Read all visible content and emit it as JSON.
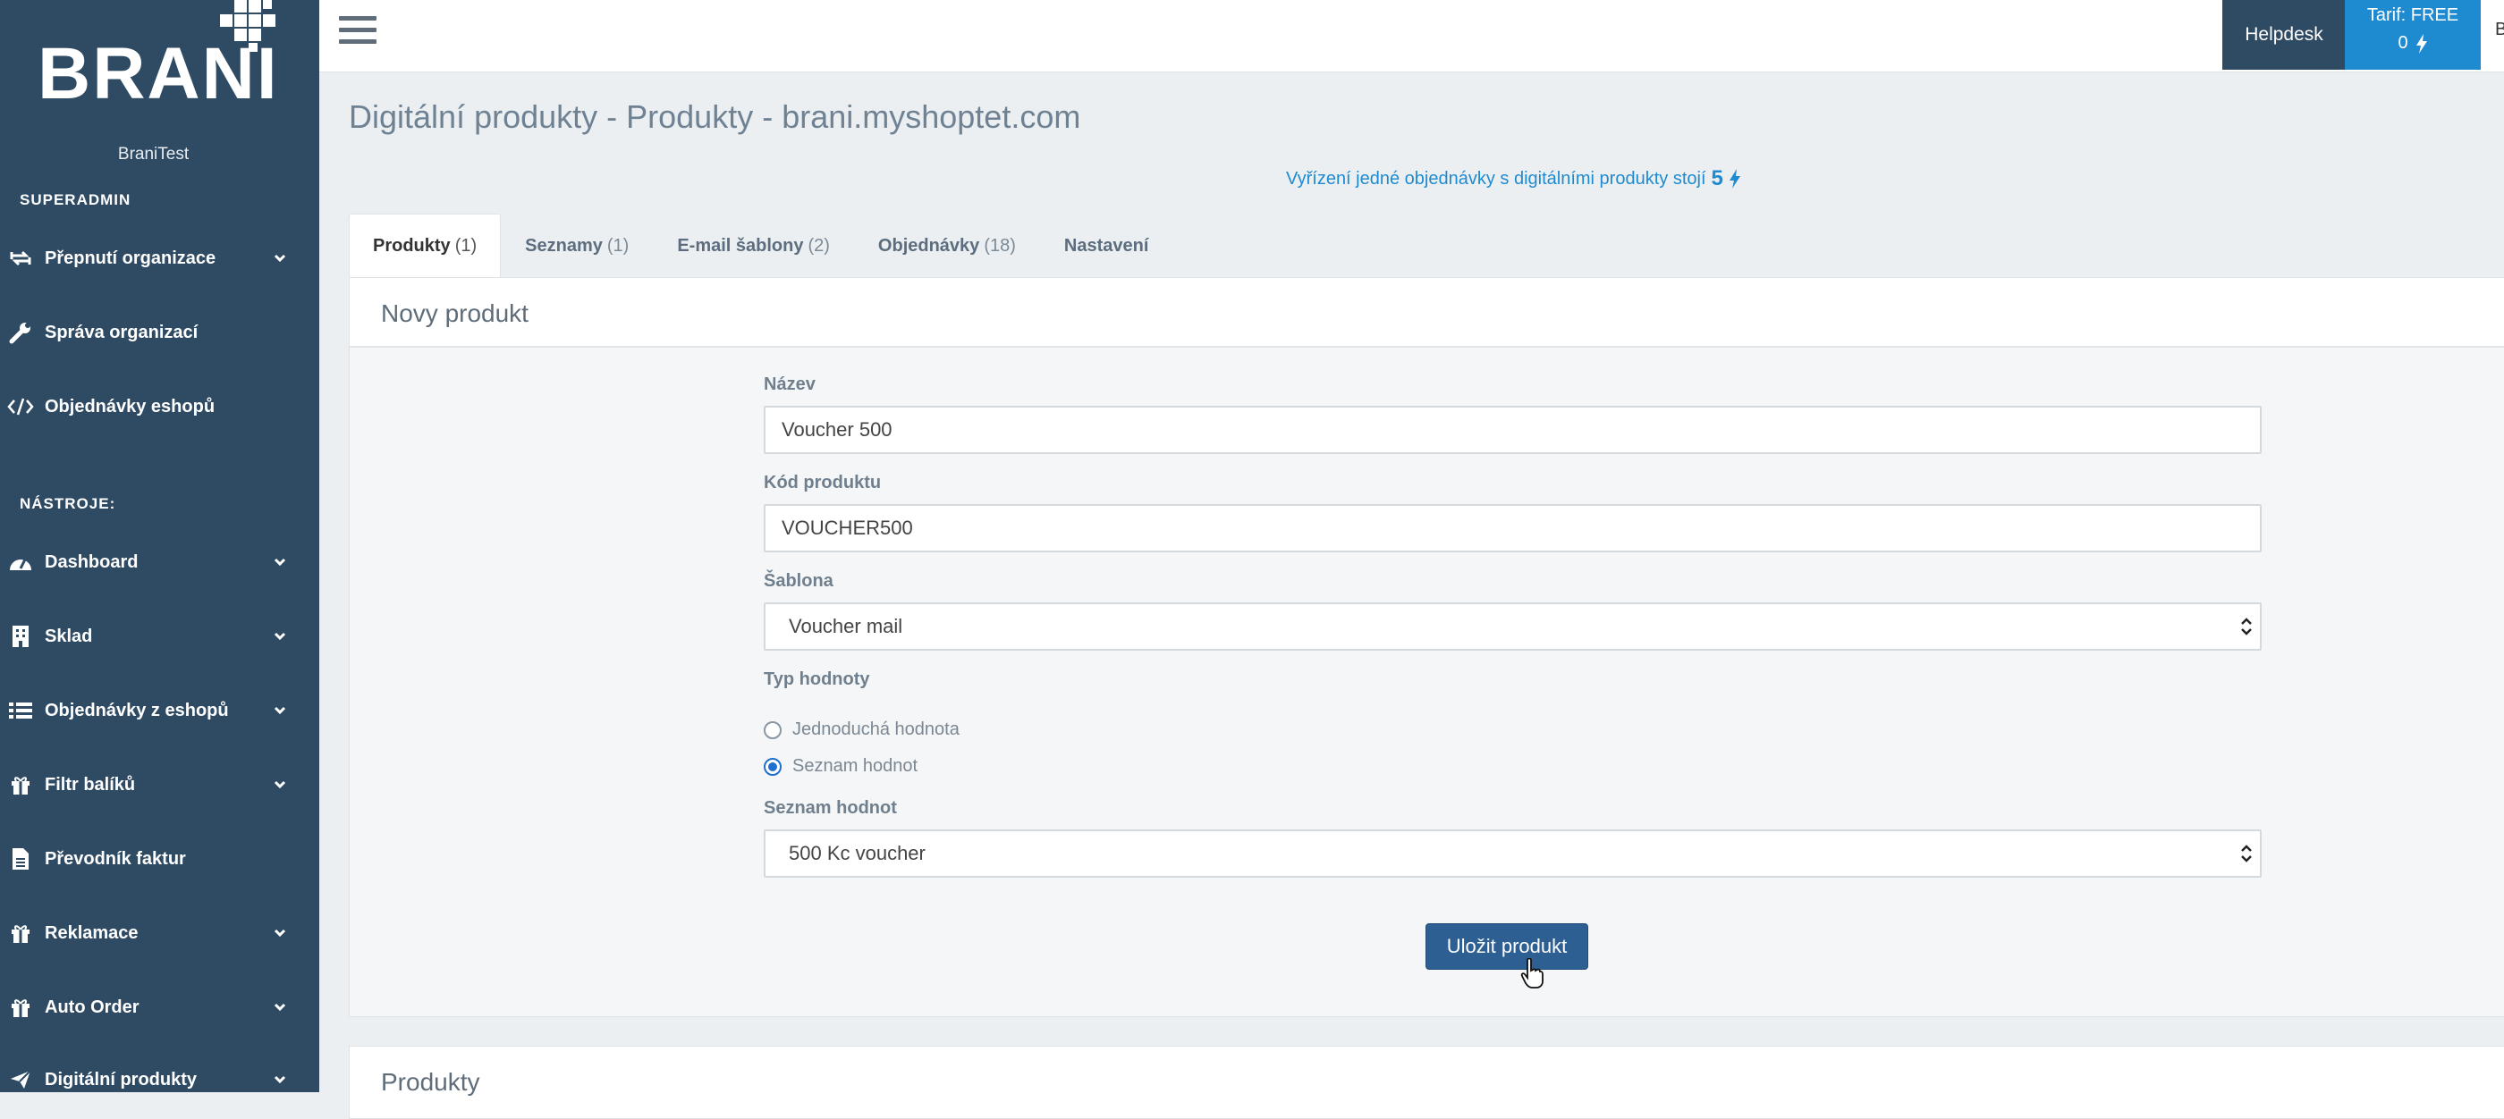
{
  "sidebar": {
    "logo_text": "BRANI",
    "org_name": "BraniTest",
    "superadmin_label": "SUPERADMIN",
    "admin_items": [
      {
        "label": "Přepnutí organizace",
        "icon": "switch-icon",
        "has_chevron": true
      },
      {
        "label": "Správa organizací",
        "icon": "wrench-icon",
        "has_chevron": false
      },
      {
        "label": "Objednávky eshopů",
        "icon": "code-icon",
        "has_chevron": false
      }
    ],
    "tools_label": "NÁSTROJE:",
    "tool_items": [
      {
        "label": "Dashboard",
        "icon": "dashboard-icon",
        "has_chevron": true
      },
      {
        "label": "Sklad",
        "icon": "building-icon",
        "has_chevron": true
      },
      {
        "label": "Objednávky z eshopů",
        "icon": "list-icon",
        "has_chevron": true
      },
      {
        "label": "Filtr balíků",
        "icon": "gift-icon",
        "has_chevron": true
      },
      {
        "label": "Převodník faktur",
        "icon": "document-icon",
        "has_chevron": false
      },
      {
        "label": "Reklamace",
        "icon": "gift-icon",
        "has_chevron": true
      },
      {
        "label": "Auto Order",
        "icon": "gift-icon",
        "has_chevron": true
      },
      {
        "label": "Digitální produkty",
        "icon": "send-icon",
        "has_chevron": true
      }
    ]
  },
  "topbar": {
    "helpdesk_label": "Helpdesk",
    "tarif_label": "Tarif: FREE",
    "tarif_credits": "0",
    "edge_text": "B"
  },
  "page": {
    "title": "Digitální produkty - Produkty - brani.myshoptet.com",
    "notice_text": "Vyřízení jedné objednávky s digitálními produkty stojí",
    "notice_value": "5"
  },
  "tabs": [
    {
      "label": "Produkty",
      "count": "(1)",
      "active": true
    },
    {
      "label": "Seznamy",
      "count": "(1)",
      "active": false
    },
    {
      "label": "E-mail šablony",
      "count": "(2)",
      "active": false
    },
    {
      "label": "Objednávky",
      "count": "(18)",
      "active": false
    },
    {
      "label": "Nastavení",
      "count": "",
      "active": false
    }
  ],
  "form": {
    "panel_title": "Novy produkt",
    "name_label": "Název",
    "name_value": "Voucher 500",
    "code_label": "Kód produktu",
    "code_value": "VOUCHER500",
    "template_label": "Šablona",
    "template_value": "Voucher mail",
    "value_type_label": "Typ hodnoty",
    "radio_simple": "Jednoduchá hodnota",
    "radio_list": "Seznam hodnot",
    "selected_value_type": "Seznam hodnot",
    "list_label": "Seznam hodnot",
    "list_value": "500 Kc voucher",
    "save_label": "Uložit produkt"
  },
  "products_panel": {
    "title": "Produkty"
  },
  "colors": {
    "sidebar_bg": "#2f4a63",
    "accent": "#1e8bd0",
    "button": "#2e5f93"
  }
}
